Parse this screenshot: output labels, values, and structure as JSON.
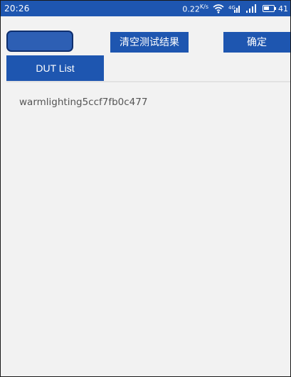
{
  "status_bar": {
    "time": "20:26",
    "net_speed": "0.22",
    "net_speed_unit": "K/s",
    "battery_level": "41",
    "color": "#1e56b0"
  },
  "toolbar": {
    "clear_results_label": "清空测试结果",
    "confirm_label": "确定",
    "accent_color": "#1e56b0"
  },
  "tabs": {
    "dut_list_label": "DUT List"
  },
  "dut_list": {
    "items": [
      {
        "name": "warmlighting5ccf7fb0c477"
      }
    ]
  }
}
